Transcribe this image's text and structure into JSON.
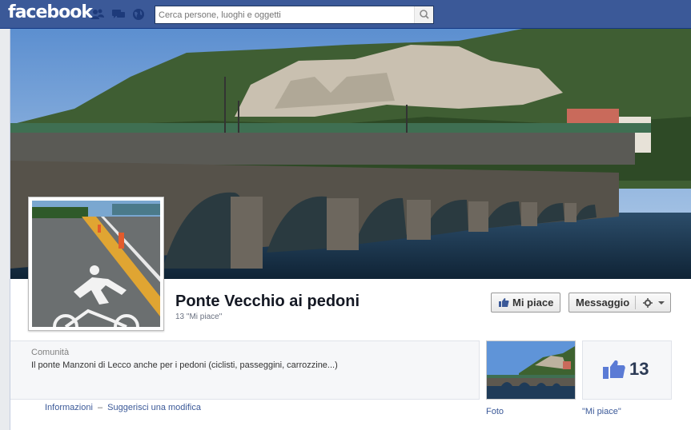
{
  "header": {
    "logo": "facebook",
    "search_placeholder": "Cerca persone, luoghi e oggetti"
  },
  "page": {
    "title": "Ponte Vecchio ai pedoni",
    "likes": "13 \"Mi piace\"",
    "category": "Comunità",
    "description": "Il ponte Manzoni di Lecco anche per i pedoni (ciclisti, passeggini, carrozzine...)"
  },
  "actions": {
    "like": "Mi piace",
    "message": "Messaggio"
  },
  "links": {
    "info": "Informazioni",
    "separator": "–",
    "suggest": "Suggerisci una modifica"
  },
  "apps": {
    "photos_label": "Foto",
    "likes_label": "\"Mi piace\"",
    "likes_number": "13"
  },
  "colors": {
    "brand": "#3b5998"
  }
}
